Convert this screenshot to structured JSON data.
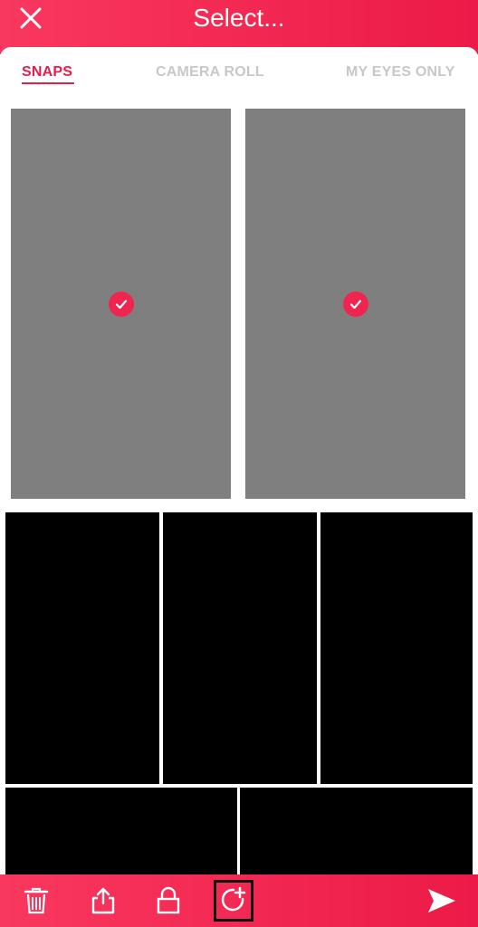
{
  "header": {
    "title": "Select...",
    "close_icon": "close-icon",
    "color": "#f0254f"
  },
  "tabs": [
    {
      "label": "SNAPS",
      "active": true
    },
    {
      "label": "CAMERA ROLL",
      "active": false
    },
    {
      "label": "MY EYES ONLY",
      "active": false
    }
  ],
  "snaps": [
    {
      "selected": true,
      "check_icon": "checkmark-icon"
    },
    {
      "selected": true,
      "check_icon": "checkmark-icon"
    }
  ],
  "toolbar": {
    "items": [
      {
        "icon": "trash-icon"
      },
      {
        "icon": "share-icon"
      },
      {
        "icon": "lock-icon"
      },
      {
        "icon": "add-to-story-icon",
        "highlighted": true
      },
      {
        "icon": "send-icon"
      }
    ]
  }
}
